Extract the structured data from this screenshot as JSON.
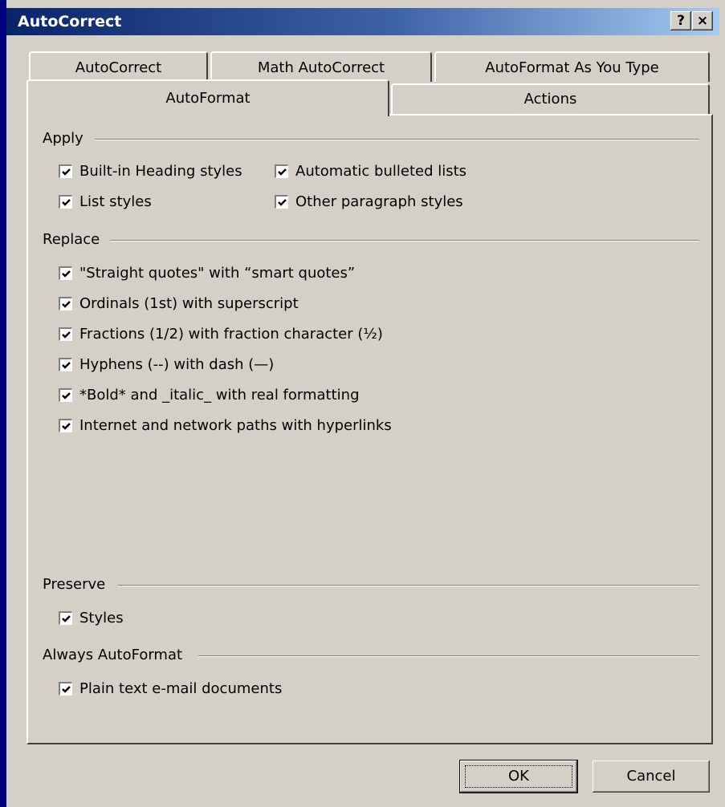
{
  "window": {
    "title": "AutoCorrect",
    "help_glyph": "?",
    "close_glyph": "×"
  },
  "tabs": [
    {
      "label": "AutoCorrect",
      "selected": false
    },
    {
      "label": "Math AutoCorrect",
      "selected": false
    },
    {
      "label": "AutoFormat As You Type",
      "selected": false
    },
    {
      "label": "AutoFormat",
      "selected": true
    },
    {
      "label": "Actions",
      "selected": false
    }
  ],
  "groups": {
    "apply": {
      "title": "Apply",
      "options": [
        {
          "label": "Built-in Heading styles",
          "checked": true
        },
        {
          "label": "Automatic bulleted lists",
          "checked": true
        },
        {
          "label": "List styles",
          "checked": true
        },
        {
          "label": "Other paragraph styles",
          "checked": true
        }
      ]
    },
    "replace": {
      "title": "Replace",
      "options": [
        {
          "label": "\"Straight quotes\" with “smart quotes”",
          "checked": true
        },
        {
          "label": "Ordinals (1st) with superscript",
          "checked": true
        },
        {
          "label": "Fractions (1/2) with fraction character (½)",
          "checked": true
        },
        {
          "label": "Hyphens (--) with dash (—)",
          "checked": true
        },
        {
          "label": "*Bold* and _italic_ with real formatting",
          "checked": true
        },
        {
          "label": "Internet and network paths with hyperlinks",
          "checked": true
        }
      ]
    },
    "preserve": {
      "title": "Preserve",
      "options": [
        {
          "label": "Styles",
          "checked": true
        }
      ]
    },
    "always": {
      "title": "Always AutoFormat",
      "options": [
        {
          "label": "Plain text e-mail documents",
          "checked": true
        }
      ]
    }
  },
  "buttons": {
    "ok": "OK",
    "cancel": "Cancel"
  }
}
